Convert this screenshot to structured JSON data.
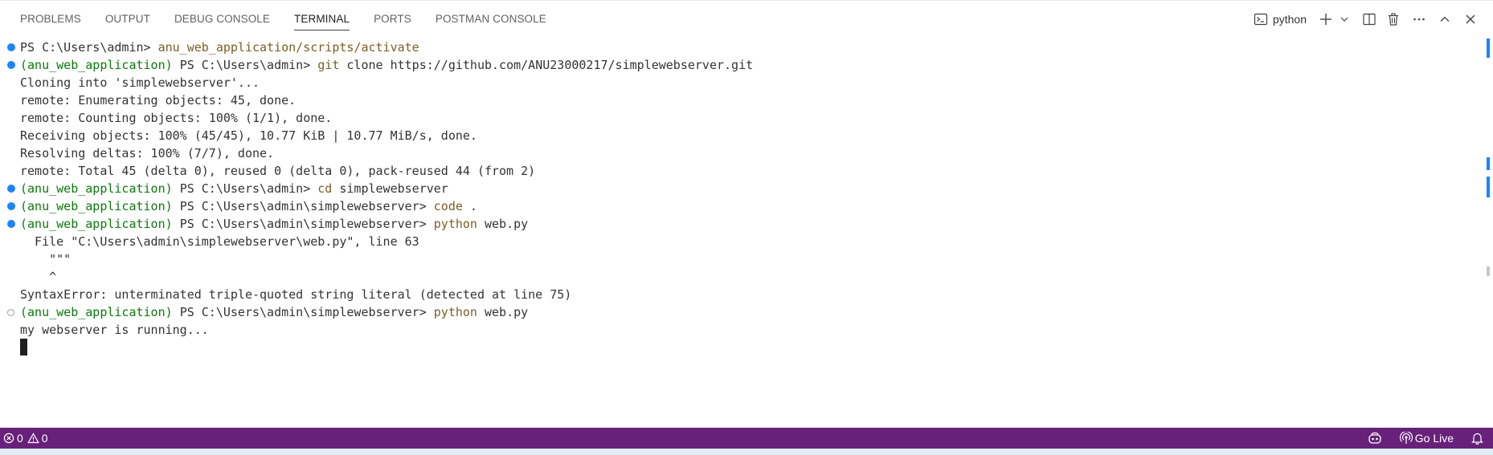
{
  "panel": {
    "tabs": [
      {
        "label": "PROBLEMS",
        "active": false
      },
      {
        "label": "OUTPUT",
        "active": false
      },
      {
        "label": "DEBUG CONSOLE",
        "active": false
      },
      {
        "label": "TERMINAL",
        "active": true
      },
      {
        "label": "PORTS",
        "active": false
      },
      {
        "label": "POSTMAN CONSOLE",
        "active": false
      }
    ],
    "terminal_name": "python",
    "actions": [
      "new-terminal-icon",
      "chevron-down-icon",
      "split-terminal-icon",
      "trash-icon",
      "more-icon",
      "maximize-panel-icon",
      "close-icon"
    ]
  },
  "terminal": {
    "lines": [
      {
        "deco": "blue",
        "segments": [
          {
            "t": "PS C:\\Users\\admin> ",
            "c": "plain"
          },
          {
            "t": "anu_web_application/scripts/activate",
            "c": "cmd"
          }
        ]
      },
      {
        "deco": "blue",
        "segments": [
          {
            "t": "(anu_web_application) ",
            "c": "env"
          },
          {
            "t": "PS C:\\Users\\admin> ",
            "c": "plain"
          },
          {
            "t": "git",
            "c": "cmd"
          },
          {
            "t": " clone https://github.com/ANU23000217/simplewebserver.git",
            "c": "plain"
          }
        ]
      },
      {
        "deco": "",
        "segments": [
          {
            "t": "Cloning into 'simplewebserver'...",
            "c": "plain"
          }
        ]
      },
      {
        "deco": "",
        "segments": [
          {
            "t": "remote: Enumerating objects: 45, done.",
            "c": "plain"
          }
        ]
      },
      {
        "deco": "",
        "segments": [
          {
            "t": "remote: Counting objects: 100% (1/1), done.",
            "c": "plain"
          }
        ]
      },
      {
        "deco": "",
        "segments": [
          {
            "t": "Receiving objects: 100% (45/45), 10.77 KiB | 10.77 MiB/s, done.",
            "c": "plain"
          }
        ]
      },
      {
        "deco": "",
        "segments": [
          {
            "t": "Resolving deltas: 100% (7/7), done.",
            "c": "plain"
          }
        ]
      },
      {
        "deco": "",
        "segments": [
          {
            "t": "remote: Total 45 (delta 0), reused 0 (delta 0), pack-reused 44 (from 2)",
            "c": "plain"
          }
        ]
      },
      {
        "deco": "blue",
        "segments": [
          {
            "t": "(anu_web_application) ",
            "c": "env"
          },
          {
            "t": "PS C:\\Users\\admin> ",
            "c": "plain"
          },
          {
            "t": "cd",
            "c": "cmd"
          },
          {
            "t": " simplewebserver",
            "c": "plain"
          }
        ]
      },
      {
        "deco": "blue",
        "segments": [
          {
            "t": "(anu_web_application) ",
            "c": "env"
          },
          {
            "t": "PS C:\\Users\\admin\\simplewebserver> ",
            "c": "plain"
          },
          {
            "t": "code",
            "c": "cmd"
          },
          {
            "t": " .",
            "c": "plain"
          }
        ]
      },
      {
        "deco": "blue",
        "segments": [
          {
            "t": "(anu_web_application) ",
            "c": "env"
          },
          {
            "t": "PS C:\\Users\\admin\\simplewebserver> ",
            "c": "plain"
          },
          {
            "t": "python",
            "c": "cmd"
          },
          {
            "t": " web.py",
            "c": "plain"
          }
        ]
      },
      {
        "deco": "",
        "segments": [
          {
            "t": "  File \"C:\\Users\\admin\\simplewebserver\\web.py\", line 63",
            "c": "plain"
          }
        ]
      },
      {
        "deco": "",
        "segments": [
          {
            "t": "    \"\"\"",
            "c": "plain"
          }
        ]
      },
      {
        "deco": "",
        "segments": [
          {
            "t": "    ^",
            "c": "plain"
          }
        ]
      },
      {
        "deco": "",
        "segments": [
          {
            "t": "SyntaxError: unterminated triple-quoted string literal (detected at line 75)",
            "c": "plain"
          }
        ]
      },
      {
        "deco": "hollow",
        "segments": [
          {
            "t": "(anu_web_application) ",
            "c": "env"
          },
          {
            "t": "PS C:\\Users\\admin\\simplewebserver> ",
            "c": "plain"
          },
          {
            "t": "python",
            "c": "cmd"
          },
          {
            "t": " web.py",
            "c": "plain"
          }
        ]
      },
      {
        "deco": "",
        "segments": [
          {
            "t": "my webserver is running...",
            "c": "plain"
          }
        ]
      }
    ]
  },
  "status_bar": {
    "errors": "0",
    "warnings": "0",
    "go_live": "Go Live",
    "icons": [
      "error-icon",
      "warning-icon",
      "copilot-icon",
      "broadcast-icon",
      "bell-icon"
    ]
  },
  "colors": {
    "status_bar": "#68217a",
    "decoration_blue": "#1a85ff",
    "env_prefix": "#0b7a0b",
    "command": "#795e26"
  }
}
